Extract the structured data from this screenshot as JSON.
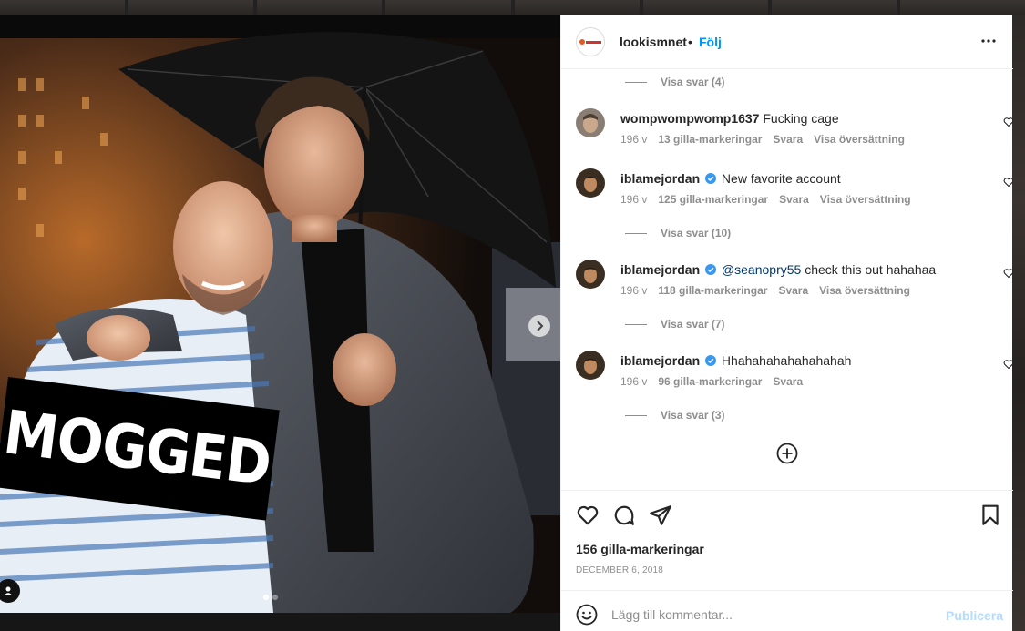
{
  "post": {
    "image_alt": "",
    "overlay_text": "MOGGED",
    "carousel": {
      "dots": 2,
      "active_index": 0
    }
  },
  "header": {
    "username": "lookismnet",
    "separator": "•",
    "follow_label": "Följ",
    "avatar_icon": "lookism-logo-icon"
  },
  "comments": [
    {
      "type": "replies",
      "label": "Visa svar (4)"
    },
    {
      "type": "comment",
      "username": "wompwompwomp1637",
      "verified": false,
      "text": "Fucking cage",
      "mention": "",
      "age": "196 v",
      "likes": "13 gilla-markeringar",
      "reply": "Svara",
      "translate": "Visa översättning"
    },
    {
      "type": "comment",
      "username": "iblamejordan",
      "verified": true,
      "text": "New favorite account",
      "mention": "",
      "age": "196 v",
      "likes": "125 gilla-markeringar",
      "reply": "Svara",
      "translate": "Visa översättning"
    },
    {
      "type": "replies",
      "label": "Visa svar (10)"
    },
    {
      "type": "comment",
      "username": "iblamejordan",
      "verified": true,
      "text": "check this out hahahaa",
      "mention": "@seanopry55",
      "age": "196 v",
      "likes": "118 gilla-markeringar",
      "reply": "Svara",
      "translate": "Visa översättning"
    },
    {
      "type": "replies",
      "label": "Visa svar (7)"
    },
    {
      "type": "comment",
      "username": "iblamejordan",
      "verified": true,
      "text": "Hhahahahahahahahah",
      "mention": "",
      "age": "196 v",
      "likes": "96 gilla-markeringar",
      "reply": "Svara",
      "translate": ""
    },
    {
      "type": "replies",
      "label": "Visa svar (3)"
    }
  ],
  "actions": {
    "likes": "156 gilla-markeringar",
    "date": "DECEMBER 6, 2018"
  },
  "add_comment": {
    "placeholder": "Lägg till kommentar...",
    "publish_label": "Publicera"
  },
  "colors": {
    "accent": "#0095f6",
    "publish_disabled": "#b3dbff",
    "muted_text": "#8e8e8e",
    "mention": "#00376b"
  }
}
